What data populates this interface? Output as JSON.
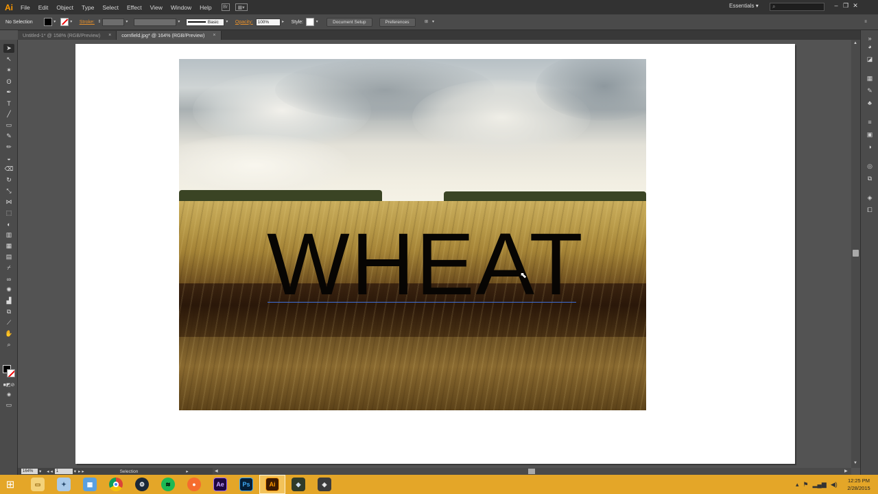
{
  "app": {
    "logo": "Ai",
    "menu": [
      "File",
      "Edit",
      "Object",
      "Type",
      "Select",
      "Effect",
      "View",
      "Window",
      "Help"
    ],
    "workspace": "Essentials",
    "colors": {
      "accent": "#ff9a00",
      "menubar": "#323232",
      "panel": "#4b4b4b",
      "canvas_bg": "#535353",
      "taskbar": "#e4a628",
      "baseline": "#3d6fd8"
    }
  },
  "controlbar": {
    "selection": "No Selection",
    "stroke_label": "Stroke:",
    "brush": "Basic",
    "opacity_label": "Opacity:",
    "opacity_value": "100%",
    "style_label": "Style:",
    "document_setup": "Document Setup",
    "preferences": "Preferences"
  },
  "tabs": [
    {
      "label": "Untitled-1* @ 158% (RGB/Preview)",
      "active": false
    },
    {
      "label": "cornfield.jpg* @ 164% (RGB/Preview)",
      "active": true
    }
  ],
  "artwork": {
    "text": "WHEAT"
  },
  "status": {
    "zoom": "164%",
    "artboard": "1",
    "tool": "Selection"
  },
  "taskbar": {
    "apps": [
      {
        "name": "file-explorer",
        "icon": "folder-icon"
      },
      {
        "name": "tools",
        "icon": "wrench-icon"
      },
      {
        "name": "calculator",
        "icon": "calculator-icon"
      },
      {
        "name": "chrome",
        "icon": "chrome-icon"
      },
      {
        "name": "steam",
        "icon": "steam-icon"
      },
      {
        "name": "spotify",
        "icon": "spotify-icon"
      },
      {
        "name": "origin",
        "icon": "origin-icon"
      },
      {
        "name": "after-effects",
        "label": "Ae"
      },
      {
        "name": "photoshop",
        "label": "Ps"
      },
      {
        "name": "illustrator",
        "label": "Ai",
        "active": true
      },
      {
        "name": "app-1",
        "icon": "game-icon"
      },
      {
        "name": "app-2",
        "icon": "game-icon"
      }
    ],
    "time": "12:25 PM",
    "date": "2/28/2015"
  }
}
